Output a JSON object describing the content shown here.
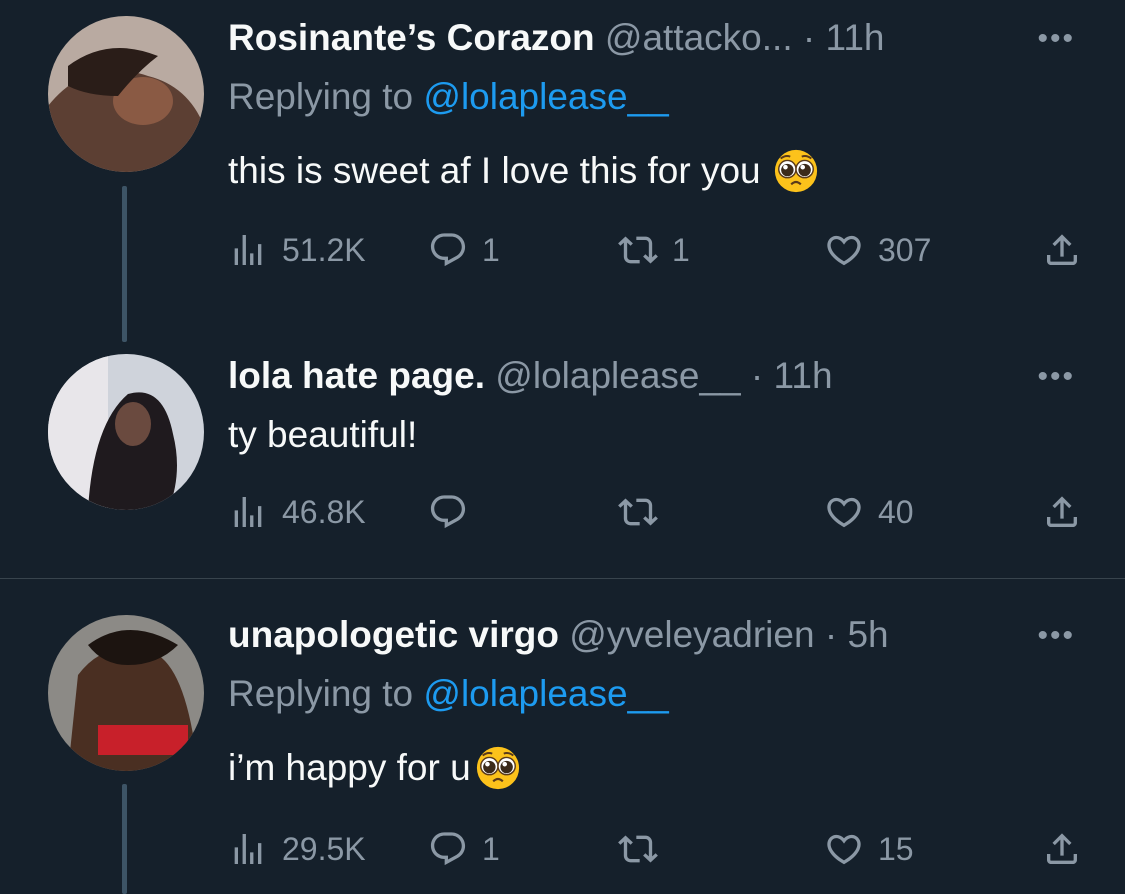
{
  "tweets": [
    {
      "name": "Rosinante’s Corazon",
      "handle": "@attacko...",
      "dot": "·",
      "time": "11h",
      "replying_prefix": "Replying to ",
      "replying_mention": "@lolaplease__",
      "text": "this is sweet af I love this for you",
      "emoji": "pleading-face",
      "views": "51.2K",
      "replies": "1",
      "retweets": "1",
      "likes": "307"
    },
    {
      "name": "lola hate page.",
      "handle": "@lolaplease__",
      "dot": "·",
      "time": "11h",
      "text": "ty beautiful!",
      "views": "46.8K",
      "replies": "",
      "retweets": "",
      "likes": "40"
    },
    {
      "name": "unapologetic virgo",
      "handle": "@yveleyadrien",
      "dot": "·",
      "time": "5h",
      "replying_prefix": "Replying to ",
      "replying_mention": "@lolaplease__",
      "text": "i’m happy for u",
      "emoji": "pleading-face",
      "views": "29.5K",
      "replies": "1",
      "retweets": "",
      "likes": "15"
    }
  ],
  "more_glyph": "•••",
  "colors": {
    "background": "#15202b",
    "text": "#f7f9f9",
    "secondary": "#8b98a5",
    "link": "#1d9bf0",
    "divider": "#38444d"
  }
}
